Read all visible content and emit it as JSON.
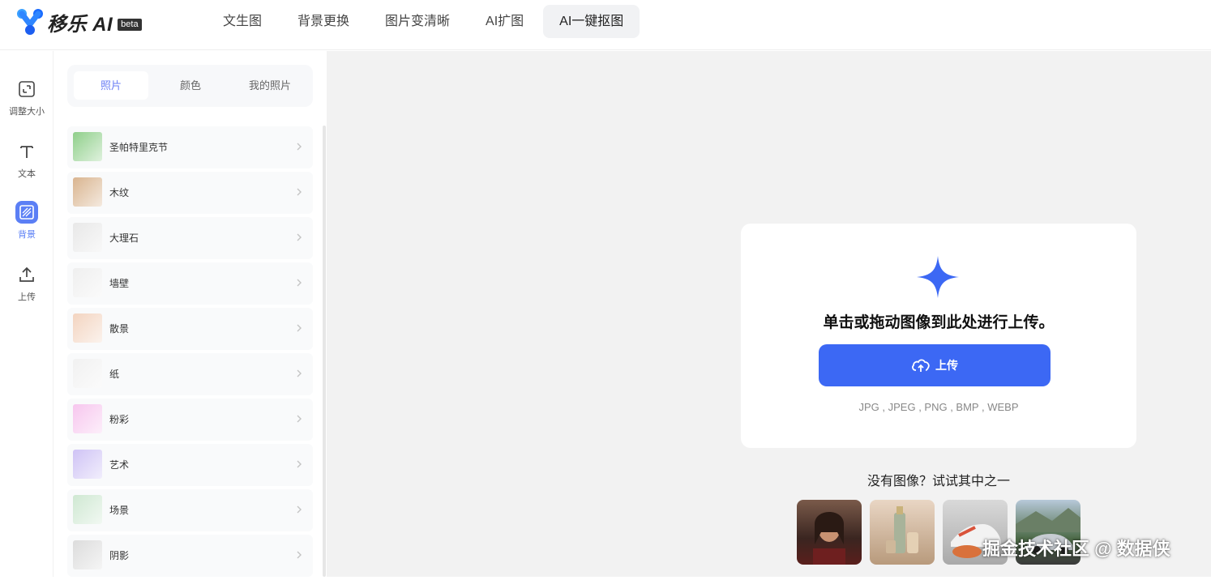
{
  "brand": {
    "name": "移乐 AI",
    "badge": "beta"
  },
  "nav": [
    {
      "label": "文生图",
      "active": false
    },
    {
      "label": "背景更换",
      "active": false
    },
    {
      "label": "图片变清晰",
      "active": false
    },
    {
      "label": "AI扩图",
      "active": false
    },
    {
      "label": "AI一键抠图",
      "active": true
    }
  ],
  "rail": [
    {
      "label": "调整大小",
      "icon": "resize-icon",
      "active": false
    },
    {
      "label": "文本",
      "icon": "text-icon",
      "active": false
    },
    {
      "label": "背景",
      "icon": "background-icon",
      "active": true
    },
    {
      "label": "上传",
      "icon": "upload-icon",
      "active": false
    }
  ],
  "panel": {
    "tabs": [
      {
        "label": "照片",
        "active": true
      },
      {
        "label": "颜色",
        "active": false
      },
      {
        "label": "我的照片",
        "active": false
      }
    ],
    "categories": [
      {
        "label": "圣帕特里克节",
        "color": "#8fcf8a"
      },
      {
        "label": "木纹",
        "color": "#d9b48f"
      },
      {
        "label": "大理石",
        "color": "#e8e8e8"
      },
      {
        "label": "墙壁",
        "color": "#efefef"
      },
      {
        "label": "散景",
        "color": "#f3d4c0"
      },
      {
        "label": "纸",
        "color": "#f1f1f1"
      },
      {
        "label": "粉彩",
        "color": "#f7c6ee"
      },
      {
        "label": "艺术",
        "color": "#cfc3f5"
      },
      {
        "label": "场景",
        "color": "#cfe8d2"
      },
      {
        "label": "阴影",
        "color": "#dcdcdc"
      }
    ]
  },
  "upload": {
    "title": "单击或拖动图像到此处进行上传。",
    "button_label": "上传",
    "formats": "JPG , JPEG , PNG , BMP , WEBP"
  },
  "samples": {
    "title": "没有图像？试试其中之一",
    "items": [
      {
        "name": "portrait-sample"
      },
      {
        "name": "bottles-sample"
      },
      {
        "name": "sneaker-sample"
      },
      {
        "name": "car-sample"
      }
    ]
  },
  "watermark": "掘金技术社区 @ 数据侠",
  "colors": {
    "accent": "#3c68f4",
    "active_tab_text": "#6b7ff5",
    "canvas_bg": "#f2f2f2"
  }
}
